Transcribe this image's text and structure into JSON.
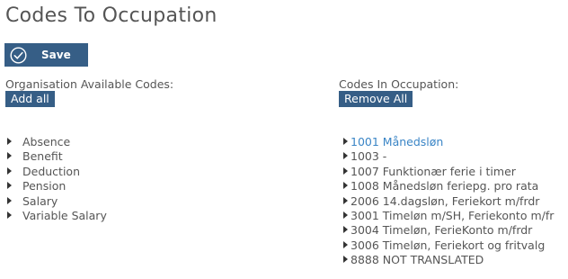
{
  "page": {
    "title": "Codes To Occupation"
  },
  "toolbar": {
    "save_label": "Save",
    "save_icon": "check-circle-icon"
  },
  "available": {
    "heading": "Organisation Available Codes:",
    "add_all_label": "Add all",
    "items": [
      {
        "label": "Absence"
      },
      {
        "label": "Benefit"
      },
      {
        "label": "Deduction"
      },
      {
        "label": "Pension"
      },
      {
        "label": "Salary"
      },
      {
        "label": "Variable Salary"
      }
    ]
  },
  "occupation": {
    "heading": "Codes In Occupation:",
    "remove_all_label": "Remove All",
    "items": [
      {
        "label": "1001 Månedsløn",
        "highlighted": true
      },
      {
        "label": "1003 -"
      },
      {
        "label": "1007 Funktionær ferie i timer"
      },
      {
        "label": "1008 Månedsløn feriepg. pro rata"
      },
      {
        "label": "2006 14.dagsløn, Feriekort m/frdr"
      },
      {
        "label": "3001 Timeløn m/SH, Feriekonto m/fr"
      },
      {
        "label": "3004 Timeløn, FerieKonto m/frdr"
      },
      {
        "label": "3006 Timeløn, Feriekort og fritvalg"
      },
      {
        "label": "8888 NOT TRANSLATED"
      }
    ]
  },
  "colors": {
    "button_bg": "#365e86",
    "link_highlight": "#3a85c6",
    "text": "#555555"
  }
}
